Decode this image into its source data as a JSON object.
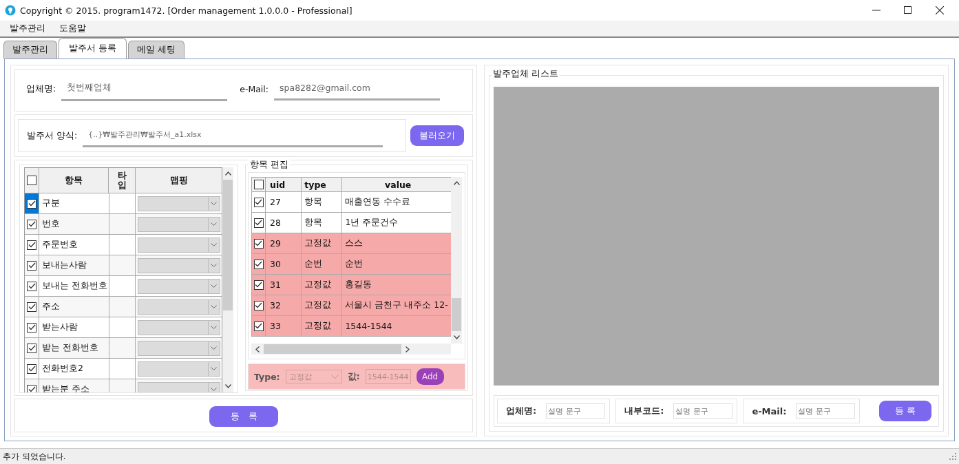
{
  "window": {
    "title": "Copyright © 2015. program1472. [Order management 1.0.0.0 - Professional]"
  },
  "menu": [
    "발주관리",
    "도움말"
  ],
  "tabs": [
    {
      "label": "발주관리",
      "selected": false
    },
    {
      "label": "발주서 등록",
      "selected": true
    },
    {
      "label": "메일 세팅",
      "selected": false
    }
  ],
  "company": {
    "label": "업체명:",
    "value": "첫번째업체"
  },
  "email": {
    "label": "e-Mail:",
    "value": "spa8282@gmail.com"
  },
  "template": {
    "label": "발주서 양식:",
    "value": "{..}₩발주관리₩발주서_a1.xlsx",
    "button": "불러오기"
  },
  "mapping_table": {
    "all_checked": false,
    "columns": [
      "항목",
      "타입",
      "맵핑"
    ],
    "rows": [
      {
        "checked": true,
        "selected": true,
        "item": "구분"
      },
      {
        "checked": true,
        "selected": false,
        "item": "번호"
      },
      {
        "checked": true,
        "selected": false,
        "item": "주문번호"
      },
      {
        "checked": true,
        "selected": false,
        "item": "보내는사람"
      },
      {
        "checked": true,
        "selected": false,
        "item": "보내는 전화번호"
      },
      {
        "checked": true,
        "selected": false,
        "item": "주소"
      },
      {
        "checked": true,
        "selected": false,
        "item": "받는사람"
      },
      {
        "checked": true,
        "selected": false,
        "item": "받는 전화번호"
      },
      {
        "checked": true,
        "selected": false,
        "item": "전화번호2"
      },
      {
        "checked": true,
        "selected": false,
        "item": "받는분 주소"
      }
    ]
  },
  "item_edit": {
    "title": "항목 편집",
    "all_checked": false,
    "columns": [
      "uid",
      "type",
      "value"
    ],
    "rows": [
      {
        "checked": true,
        "highlighted": false,
        "uid": "27",
        "type": "항목",
        "value": "매출연동 수수료"
      },
      {
        "checked": true,
        "highlighted": false,
        "uid": "28",
        "type": "항목",
        "value": "1년 주문건수"
      },
      {
        "checked": true,
        "highlighted": true,
        "uid": "29",
        "type": "고정값",
        "value": "스스"
      },
      {
        "checked": true,
        "highlighted": true,
        "uid": "30",
        "type": "순번",
        "value": "순번"
      },
      {
        "checked": true,
        "highlighted": true,
        "uid": "31",
        "type": "고정값",
        "value": "홍길동"
      },
      {
        "checked": true,
        "highlighted": true,
        "uid": "32",
        "type": "고정값",
        "value": "서울시 금천구 내주소 12-"
      },
      {
        "checked": true,
        "highlighted": true,
        "uid": "33",
        "type": "고정값",
        "value": "1544-1544"
      }
    ],
    "form": {
      "highlighted": true,
      "type_label": "Type:",
      "type_value": "고정값",
      "value_label": "값:",
      "value": "1544-1544",
      "add_button": "Add"
    }
  },
  "register_button": "등　록",
  "vendor_list": {
    "title": "발주업체 리스트",
    "fields": [
      {
        "label": "업체명:",
        "placeholder": "설명 문구"
      },
      {
        "label": "내부코드:",
        "placeholder": "설명 문구"
      },
      {
        "label": "e-Mail:",
        "placeholder": "설명 문구"
      }
    ],
    "register_button": "등 록"
  },
  "status_bar": "추가 되었습니다."
}
